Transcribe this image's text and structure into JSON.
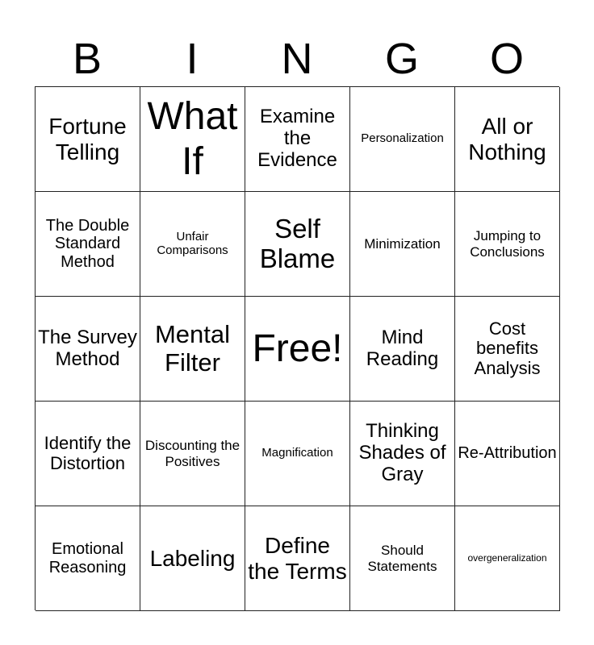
{
  "header": {
    "letters": [
      "B",
      "I",
      "N",
      "G",
      "O"
    ]
  },
  "grid": {
    "cells": [
      "Fortune Telling",
      "What If",
      "Examine the Evidence",
      "Personalization",
      "All or Nothing",
      "The Double Standard Method",
      "Unfair Comparisons",
      "Self Blame",
      "Minimization",
      "Jumping to Conclusions",
      "The Survey Method",
      "Mental Filter",
      "Free!",
      "Mind Reading",
      "Cost benefits Analysis",
      "Identify the Distortion",
      "Discounting the Positives",
      "Magnification",
      "Thinking Shades of Gray",
      "Re-Attribution",
      "Emotional Reasoning",
      "Labeling",
      "Define the Terms",
      "Should Statements",
      "overgeneralization"
    ]
  }
}
